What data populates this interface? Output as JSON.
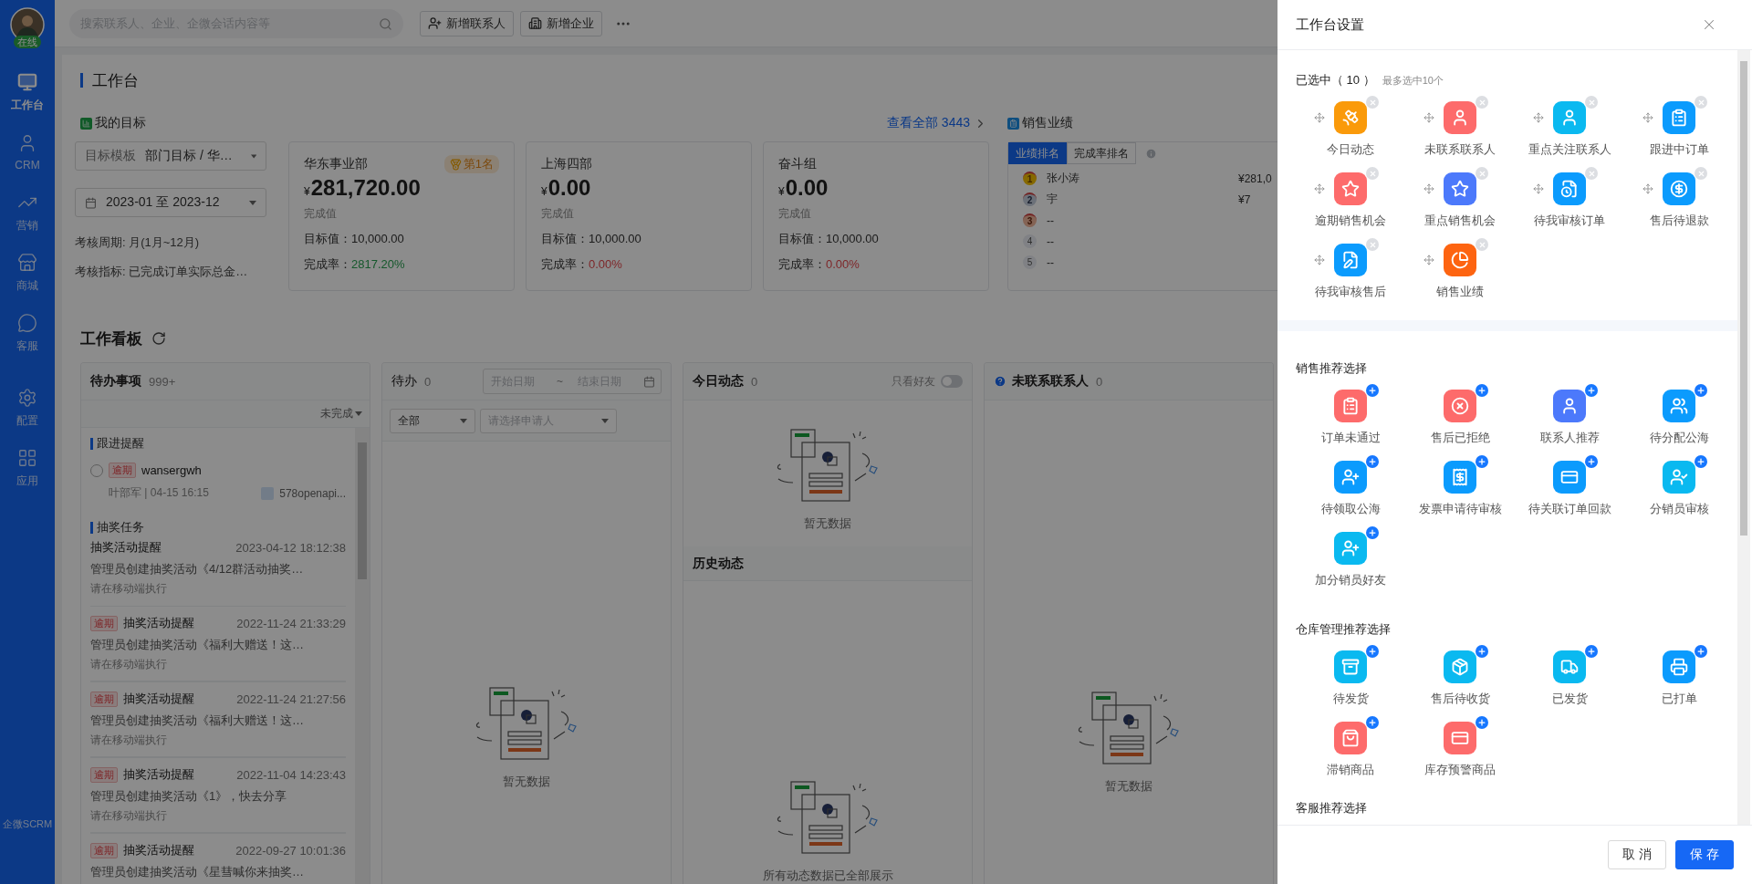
{
  "sidebar": {
    "status": "在线",
    "brand": "企微SCRM",
    "items": [
      {
        "label": "工作台",
        "selected": true
      },
      {
        "label": "CRM",
        "selected": false
      },
      {
        "label": "营销",
        "selected": false
      },
      {
        "label": "商城",
        "selected": false
      },
      {
        "label": "客服",
        "selected": false
      },
      {
        "label": "配置",
        "selected": false
      },
      {
        "label": "应用",
        "selected": false
      }
    ]
  },
  "topbar": {
    "search": {
      "placeholder": "搜索联系人、企业、企微会话内容等"
    },
    "buttons": [
      {
        "label": "新增联系人"
      },
      {
        "label": "新增企业"
      }
    ]
  },
  "workbench": {
    "title": "工作台",
    "goals": {
      "heading": "我的目标",
      "view_all": "查看全部 3443",
      "template": {
        "label": "目标模板",
        "value": "部门目标 / 华…"
      },
      "date_range": "2023-01 至 2023-12",
      "period": "考核周期: 月(1月~12月)",
      "indicator": "考核指标: 已完成订单实际总金…",
      "cards": [
        {
          "name": "华东事业部",
          "rank": "第1名",
          "currency": "¥",
          "amount": "281,720.00",
          "amount_label": "完成值",
          "target": "目标值：10,000.00",
          "rate_label": "完成率：",
          "rate": "2817.20%",
          "rate_met": true
        },
        {
          "name": "上海四部",
          "currency": "¥",
          "amount": "0.00",
          "amount_label": "完成值",
          "target": "目标值：10,000.00",
          "rate_label": "完成率：",
          "rate": "0.00%",
          "rate_met": false
        },
        {
          "name": "奋斗组",
          "currency": "¥",
          "amount": "0.00",
          "amount_label": "完成值",
          "target": "目标值：10,000.00",
          "rate_label": "完成率：",
          "rate": "0.00%",
          "rate_met": false
        }
      ]
    },
    "sales": {
      "heading": "销售业绩",
      "tabs": [
        {
          "label": "业绩排名",
          "selected": true
        },
        {
          "label": "完成率排名",
          "selected": false
        }
      ],
      "ranking": [
        {
          "rank": "1",
          "kind": "gold",
          "name": "张小涛",
          "amount": "¥281,0"
        },
        {
          "rank": "2",
          "kind": "silver",
          "name": "宇",
          "amount": "¥7"
        },
        {
          "rank": "3",
          "kind": "bronze",
          "name": "--"
        },
        {
          "rank": "4",
          "kind": "number",
          "name": "--"
        },
        {
          "rank": "5",
          "kind": "number",
          "name": "--"
        }
      ]
    }
  },
  "board": {
    "title": "工作看板",
    "todo": {
      "title": "待办事项",
      "count": "999+",
      "filter": "未完成",
      "sections": [
        {
          "title": "跟进提醒",
          "kind": "follow",
          "items": [
            {
              "tag": "逾期",
              "title": "wansergwh",
              "checked": false,
              "meta": "叶部军 | 04-15 16:15",
              "company": "578openapi..."
            }
          ]
        },
        {
          "title": "抽奖任务",
          "kind": "task",
          "items": [
            {
              "title": "抽奖活动提醒",
              "time": "2023-04-12 18:12:38",
              "desc": "管理员创建抽奖活动《4/12群活动抽奖…",
              "note": "请在移动端执行"
            },
            {
              "tag": "逾期",
              "title": "抽奖活动提醒",
              "time": "2022-11-24 21:33:29",
              "desc": "管理员创建抽奖活动《福利大赠送！这…",
              "note": "请在移动端执行"
            },
            {
              "tag": "逾期",
              "title": "抽奖活动提醒",
              "time": "2022-11-24 21:27:56",
              "desc": "管理员创建抽奖活动《福利大赠送！这…",
              "note": "请在移动端执行"
            },
            {
              "tag": "逾期",
              "title": "抽奖活动提醒",
              "time": "2022-11-04 14:23:43",
              "desc": "管理员创建抽奖活动《1》，快去分享",
              "note": "请在移动端执行"
            },
            {
              "tag": "逾期",
              "title": "抽奖活动提醒",
              "time": "2022-09-27 10:01:36",
              "desc": "管理员创建抽奖活动《星彗喊你来抽奖…"
            }
          ]
        }
      ]
    },
    "pending": {
      "title": "待办",
      "count": "0",
      "start_placeholder": "开始日期",
      "separator": "~",
      "end_placeholder": "结束日期",
      "type_select": "全部",
      "applicant_placeholder": "请选择申请人",
      "empty": "暂无数据"
    },
    "today": {
      "title": "今日动态",
      "count": "0",
      "friends_only": {
        "label": "只看好友",
        "on": false
      },
      "empty": "暂无数据",
      "history_title": "历史动态",
      "history_empty": "所有动态数据已全部展示"
    },
    "uncontacted": {
      "title": "未联系联系人",
      "count": "0",
      "empty": "暂无数据"
    }
  },
  "drawer": {
    "title": "工作台设置",
    "sections": [
      {
        "title": "已选中（ 10 ）",
        "hint": "最多选中10个",
        "kind": "selected",
        "items": [
          {
            "label": "今日动态",
            "color": "#fa9a0a"
          },
          {
            "label": "未联系联系人",
            "color": "#fd6b6b"
          },
          {
            "label": "重点关注联系人",
            "color": "#0ab9f0"
          },
          {
            "label": "跟进中订单",
            "color": "#0b9bfd"
          },
          {
            "label": "逾期销售机会",
            "color": "#fd6b6b"
          },
          {
            "label": "重点销售机会",
            "color": "#4c79fb"
          },
          {
            "label": "待我审核订单",
            "color": "#0b9bfd"
          },
          {
            "label": "售后待退款",
            "color": "#0b9bfd"
          },
          {
            "label": "待我审核售后",
            "color": "#0b9bfd"
          },
          {
            "label": "销售业绩",
            "color": "#fd6411"
          }
        ]
      },
      {
        "title": "销售推荐选择",
        "kind": "recommend",
        "items": [
          {
            "label": "订单未通过",
            "color": "#fd6b6b"
          },
          {
            "label": "售后已拒绝",
            "color": "#fd6b6b"
          },
          {
            "label": "联系人推荐",
            "color": "#4c79fb"
          },
          {
            "label": "待分配公海",
            "color": "#0b9bfd"
          },
          {
            "label": "待领取公海",
            "color": "#0b9bfd"
          },
          {
            "label": "发票申请待审核",
            "color": "#0b9bfd"
          },
          {
            "label": "待关联订单回款",
            "color": "#0b9bfd"
          },
          {
            "label": "分销员审核",
            "color": "#0ab9f0"
          },
          {
            "label": "加分销员好友",
            "color": "#0ab9f0"
          }
        ]
      },
      {
        "title": "仓库管理推荐选择",
        "kind": "recommend",
        "items": [
          {
            "label": "待发货",
            "color": "#0ab9f0"
          },
          {
            "label": "售后待收货",
            "color": "#0ab9f0"
          },
          {
            "label": "已发货",
            "color": "#0ab9f0"
          },
          {
            "label": "已打单",
            "color": "#0b9bfd"
          },
          {
            "label": "滞销商品",
            "color": "#fd6b6b"
          },
          {
            "label": "库存预警商品",
            "color": "#fd6b6b"
          }
        ]
      },
      {
        "title": "客服推荐选择"
      }
    ],
    "buttons": [
      {
        "label": "取 消",
        "kind": "default"
      },
      {
        "label": "保 存",
        "kind": "primary"
      }
    ]
  }
}
